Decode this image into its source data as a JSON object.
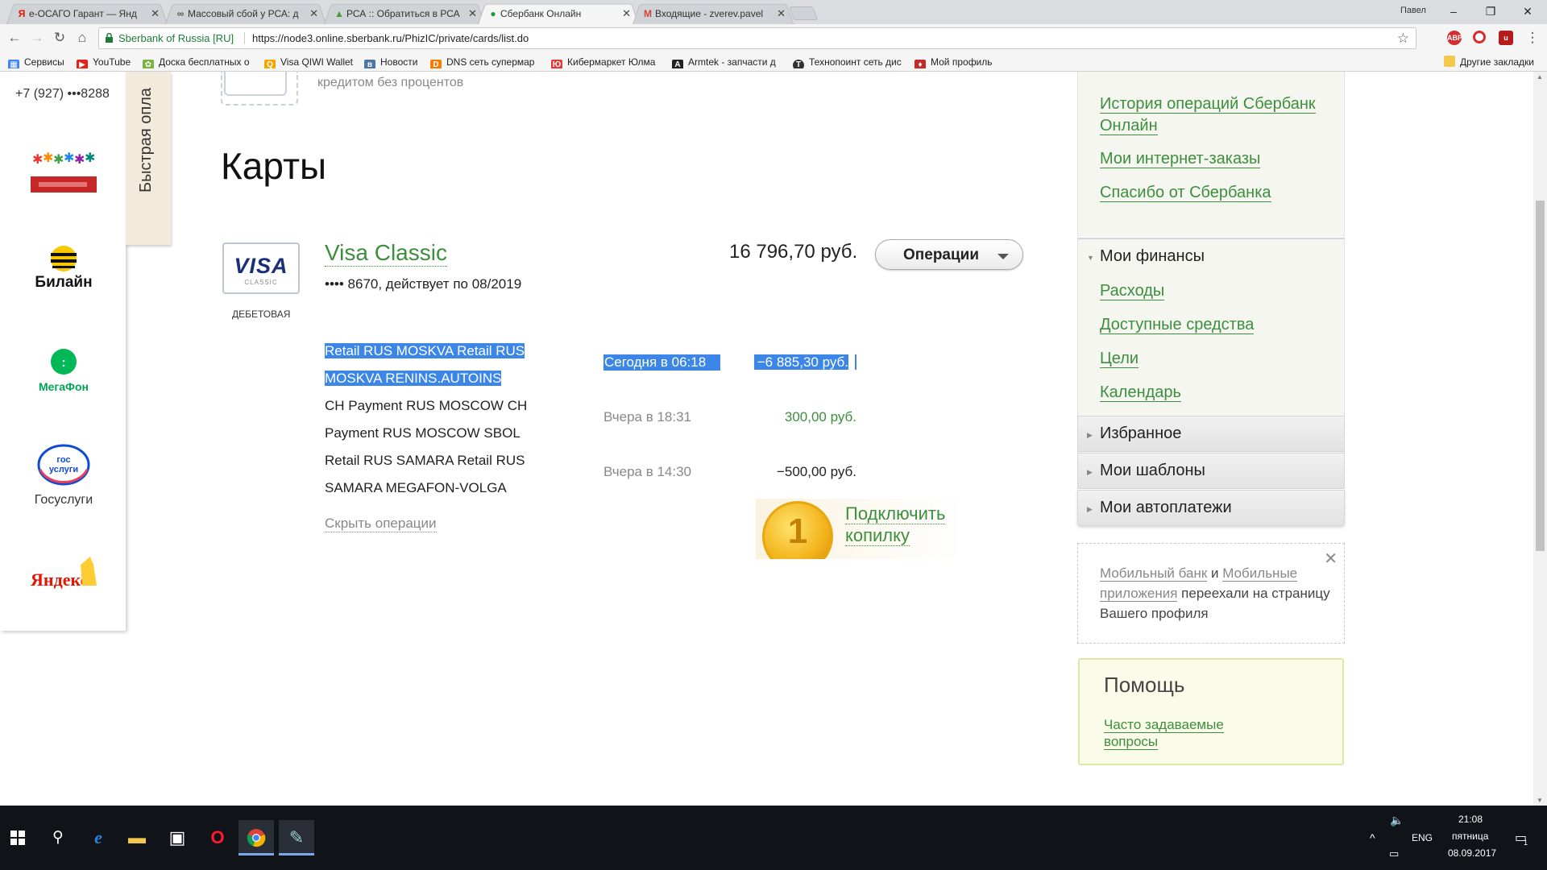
{
  "browser": {
    "tabs": [
      {
        "title": "е-ОСАГО Гарант — Янд",
        "favicon": "Я",
        "favcolor": "#e61400"
      },
      {
        "title": "Массовый сбой у РСА: д",
        "favicon": "∞",
        "favcolor": "#555"
      },
      {
        "title": "РСА :: Обратиться в РСА",
        "favicon": "▲",
        "favcolor": "#4a9a3a"
      },
      {
        "title": "Сбербанк Онлайн",
        "favicon": "●",
        "favcolor": "#21a038"
      },
      {
        "title": "Входящие - zverev.pavel",
        "favicon": "M",
        "favcolor": "#d44638"
      }
    ],
    "window_user": "Павел",
    "window_controls": {
      "minimize": "–",
      "restore": "❐",
      "close": "✕"
    },
    "site_identity": "Sberbank of Russia [RU]",
    "url": "https://node3.online.sberbank.ru/PhizIC/private/cards/list.do",
    "bookmarks": [
      {
        "label": "Сервисы",
        "color": "#4285f4",
        "glyph": "▦"
      },
      {
        "label": "YouTube",
        "color": "#e62117",
        "glyph": "▶"
      },
      {
        "label": "Доска бесплатных о",
        "color": "#7cb342",
        "glyph": "✿"
      },
      {
        "label": "Visa QIWI Wallet",
        "color": "#f7a500",
        "glyph": "Q"
      },
      {
        "label": "Новости",
        "color": "#4c75a3",
        "glyph": "в"
      },
      {
        "label": "DNS сеть супермар",
        "color": "#f57c00",
        "glyph": "D"
      },
      {
        "label": "Кибермаркет Юлма",
        "color": "#e53935",
        "glyph": "Ю"
      },
      {
        "label": "Armtek - запчасти д",
        "color": "#222",
        "glyph": "A"
      },
      {
        "label": "Технопоинт сеть дис",
        "color": "#333",
        "glyph": "T"
      },
      {
        "label": "Мой профиль",
        "color": "#c62828",
        "glyph": "♦"
      }
    ],
    "other_bookmarks": "Другие закладки"
  },
  "left": {
    "phone": "+7 (927) •••8288",
    "partners": [
      {
        "name": "Подари жизнь"
      },
      {
        "name": "Билайн"
      },
      {
        "name": "МегаФон"
      },
      {
        "name": "Госуслуги",
        "caption": "Госуслуги"
      },
      {
        "name": "Яндекс"
      }
    ],
    "quick_pay_tab": "Быстрая опла"
  },
  "main": {
    "credit_note": "кредитом без процентов",
    "title": "Карты",
    "card": {
      "logo_text": "VISA",
      "logo_sub": "CLASSIC",
      "type": "ДЕБЕТОВАЯ",
      "name": "Visa Classic",
      "number": "•••• 8670, действует по 08/2019",
      "balance": "16 796,70 руб.",
      "operations_button": "Операции"
    },
    "transactions": [
      {
        "line1": "Retail RUS MOSKVA Retail RUS",
        "line2": "MOSKVA RENINS.AUTOINS",
        "date": "Сегодня в 06:18",
        "amount": "−6 885,30 руб.",
        "selected": true
      },
      {
        "line1": "CH Payment RUS MOSCOW CH",
        "line2": "Payment RUS MOSCOW SBOL",
        "date": "Вчера в 18:31",
        "amount": "300,00 руб.",
        "income": true
      },
      {
        "line1": "Retail RUS SAMARA Retail RUS",
        "line2": "SAMARA MEGAFON-VOLGA",
        "date": "Вчера в 14:30",
        "amount": "−500,00 руб."
      }
    ],
    "hide_operations": "Скрыть операции",
    "piggy_bank": {
      "coin": "1",
      "line1": "Подключить",
      "line2": "копилку"
    }
  },
  "sidebar": {
    "links": [
      "История операций Сбербанк Онлайн",
      "Мои интернет-заказы",
      "Спасибо от Сбербанка"
    ],
    "finances_title": "Мои финансы",
    "finances_items": [
      "Расходы",
      "Доступные средства",
      "Цели",
      "Календарь"
    ],
    "sections": [
      "Избранное",
      "Мои шаблоны",
      "Мои автоплатежи"
    ],
    "notice": {
      "link1": "Мобильный банк",
      "and": " и ",
      "link2": "Мобильные приложения",
      "rest": " переехали на страницу Вашего профиля"
    },
    "help": {
      "title": "Помощь",
      "link": "Часто задаваемые вопросы"
    }
  },
  "taskbar": {
    "language": "ENG",
    "time": "21:08",
    "weekday": "пятница",
    "date": "08.09.2017",
    "notification_count": "1"
  },
  "colors": {
    "sber_green": "#3c8f3c",
    "selection": "#3c86e8",
    "visa_blue": "#1a2e7a"
  }
}
